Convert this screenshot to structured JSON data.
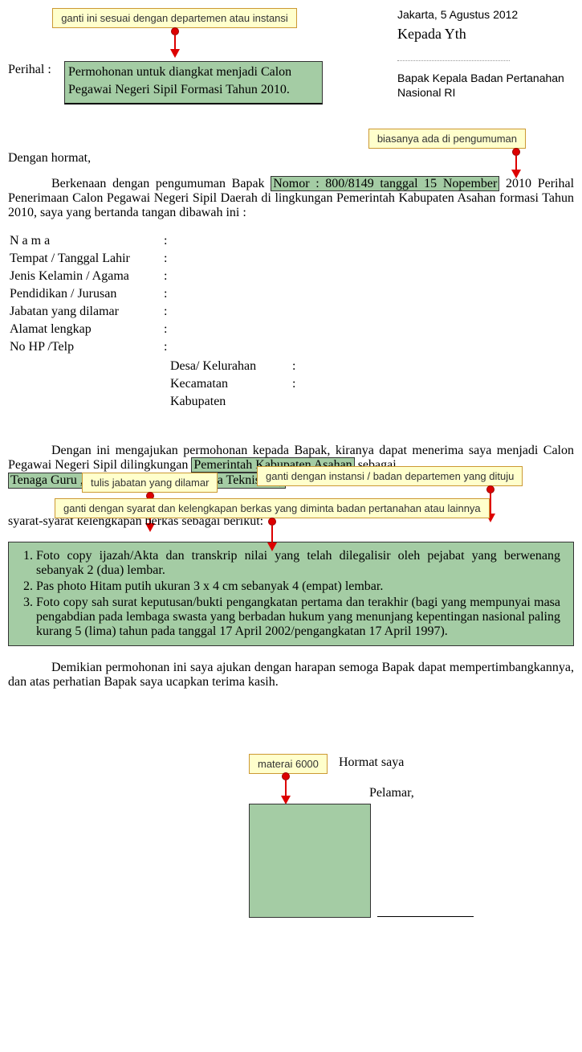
{
  "callouts": {
    "dept": "ganti ini sesuai dengan departemen atau instansi",
    "announce": "biasanya ada di pengumuman",
    "job": "tulis jabatan yang dilamar",
    "agency": "ganti dengan instansi / badan departemen yang dituju",
    "reqs": "ganti dengan syarat dan kelengkapan berkas yang diminta badan pertanahan atau lainnya",
    "stamp": "materai 6000"
  },
  "header": {
    "date": "Jakarta,  5 Agustus 2012",
    "to": "Kepada Yth",
    "recipient": "Bapak Kepala Badan Pertanahan Nasional RI"
  },
  "perihal": {
    "label": "Perihal  :",
    "text": "Permohonan untuk diangkat menjadi Calon   Pegawai Negeri Sipil Formasi Tahun 2010."
  },
  "body": {
    "salutation": "Dengan hormat,",
    "p1_a": "Berkenaan dengan pengumuman Bapak ",
    "p1_hl": "Nomor : 800/8149 tanggal 15 Nopember",
    "p1_b": "2010 Perihal Penerimaan Calon Pegawai Negeri Sipil Daerah di lingkungan Pemerintah Kabupaten Asahan formasi Tahun 2010, saya yang bertanda tangan dibawah ini :"
  },
  "fields": {
    "name": "N a m a",
    "ttl": "Tempat /  Tanggal Lahir",
    "jk": "Jenis Kelamin / Agama",
    "pend": "Pendidikan / Jurusan",
    "jab": "Jabatan yang dilamar",
    "alamat": "Alamat lengkap",
    "hp": "No HP /Telp",
    "desa": "Desa/ Kelurahan",
    "kec": "Kecamatan",
    "kab": "Kabupaten",
    "colon": ":"
  },
  "p2": {
    "a": "Dengan ini mengajukan permohonan kepada Bapak, kiranya dapat menerima saya menjadi Calon Pegawai Negeri Sipil dilingkungan ",
    "agency": "Pemerintah Kabupaten Asahan",
    "b": " sebagai ",
    "role": "Tenaga Guru , Tenaga Kesehatan, Tenaga Teknis…*)"
  },
  "p3": {
    "tail": "n syarat-syarat kelengkapan berkas sebagai berikut:"
  },
  "reqs": [
    "Foto copy ijazah/Akta dan transkrip nilai yang telah dilegalisir  oleh pejabat yang berwenang sebanyak 2 (dua) lembar.",
    "Pas photo Hitam putih ukuran 3 x 4 cm sebanyak 4 (empat) lembar.",
    "Foto copy sah surat keputusan/bukti pengangkatan pertama dan terakhir (bagi yang mempunyai masa pengabdian pada lembaga swasta yang berbadan hukum yang menunjang kepentingan nasional paling kurang 5 (lima) tahun pada tanggal 17 April 2002/pengangkatan 17 April 1997)."
  ],
  "closing": "Demikian permohonan ini saya ajukan dengan harapan semoga Bapak dapat mempertimbangkannya, dan atas perhatian Bapak saya ucapkan terima kasih.",
  "sig": {
    "hormat": "Hormat saya",
    "pelamar": "Pelamar,"
  }
}
